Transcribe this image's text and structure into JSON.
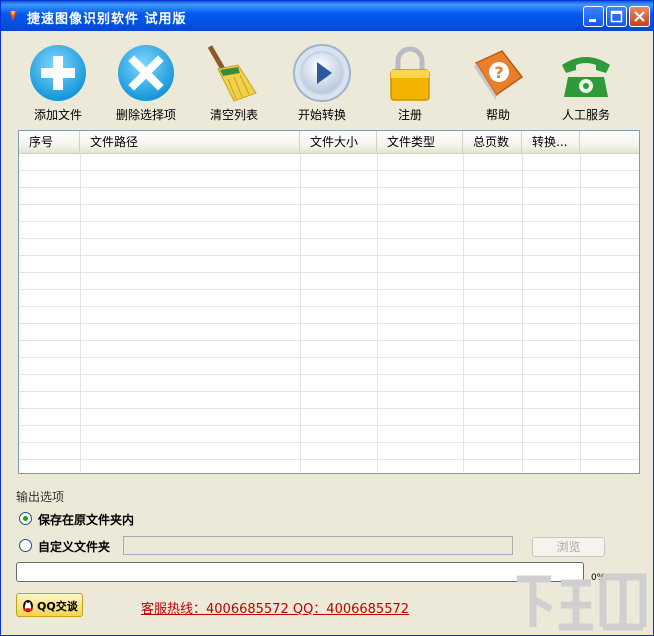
{
  "window": {
    "title": "捷速图像识别软件  试用版"
  },
  "titlebar_buttons": [
    "minimize-icon",
    "maximize-icon",
    "close-icon"
  ],
  "toolbar": {
    "items": [
      {
        "label": "添加文件",
        "icon": "plus-circle-icon",
        "color": "#27a6e6"
      },
      {
        "label": "删除选择项",
        "icon": "x-circle-icon",
        "color": "#27a6e6"
      },
      {
        "label": "清空列表",
        "icon": "broom-icon",
        "color": "#e5c230"
      },
      {
        "label": "开始转换",
        "icon": "play-circle-icon",
        "color": "#2b5a9e"
      },
      {
        "label": "注册",
        "icon": "padlock-icon",
        "color": "#f2b400"
      },
      {
        "label": "帮助",
        "icon": "help-book-icon",
        "color": "#e97f2a"
      },
      {
        "label": "人工服务",
        "icon": "telephone-icon",
        "color": "#2e9a3a"
      }
    ]
  },
  "list": {
    "columns": [
      "序号",
      "文件路径",
      "文件大小",
      "文件类型",
      "总页数",
      "转换..."
    ],
    "rows": []
  },
  "output": {
    "title": "输出选项",
    "option_original": "保存在原文件夹内",
    "option_custom": "自定义文件夹",
    "selected": "option_original",
    "path_value": "",
    "browse_label": "浏览"
  },
  "progress": {
    "value": 0,
    "label": "0%"
  },
  "footer": {
    "qq_label": "QQ交谈",
    "hotline": "客服热线：4006685572 QQ：4006685572",
    "accent": "#c00000"
  }
}
